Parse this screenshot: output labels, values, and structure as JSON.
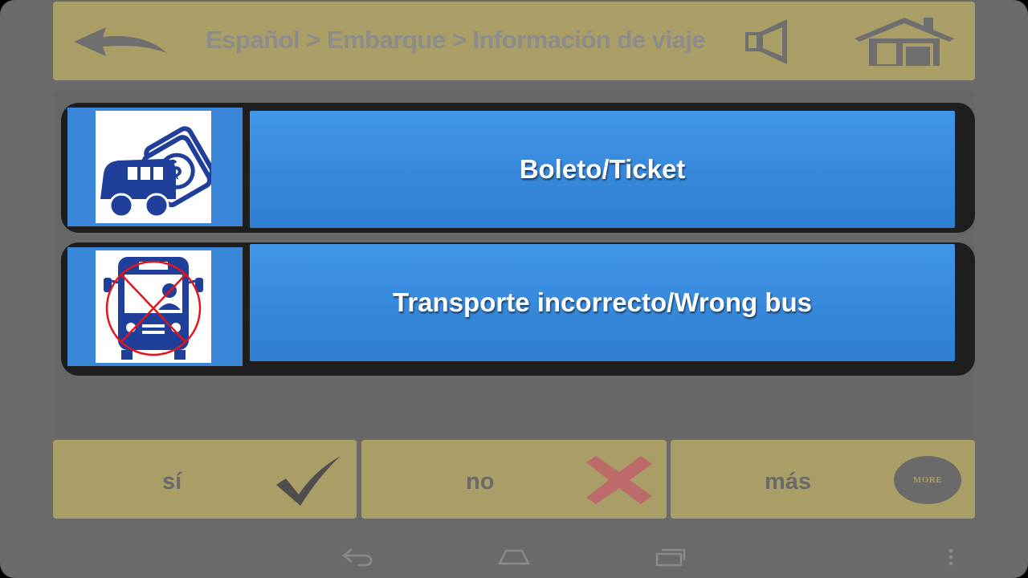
{
  "header": {
    "breadcrumb": "Español > Embarque > Información de viaje",
    "back_icon": "back-arrow-icon",
    "speaker_icon": "speaker-icon",
    "home_icon": "home-icon"
  },
  "items": [
    {
      "label": "Boleto/Ticket",
      "icon": "bus-ticket-icon"
    },
    {
      "label": "Transporte incorrecto/Wrong bus",
      "icon": "wrong-bus-icon"
    }
  ],
  "buttons": {
    "yes": {
      "label": "sí",
      "icon": "checkmark-icon"
    },
    "no": {
      "label": "no",
      "icon": "x-icon"
    },
    "more": {
      "label": "más",
      "icon": "more-icon",
      "icon_text": "MORE"
    }
  },
  "colors": {
    "header_bg": "#a99f66",
    "item_blue": "#3a87d9",
    "icon_blue": "#1f3f9a",
    "background": "#6a6a6a"
  }
}
